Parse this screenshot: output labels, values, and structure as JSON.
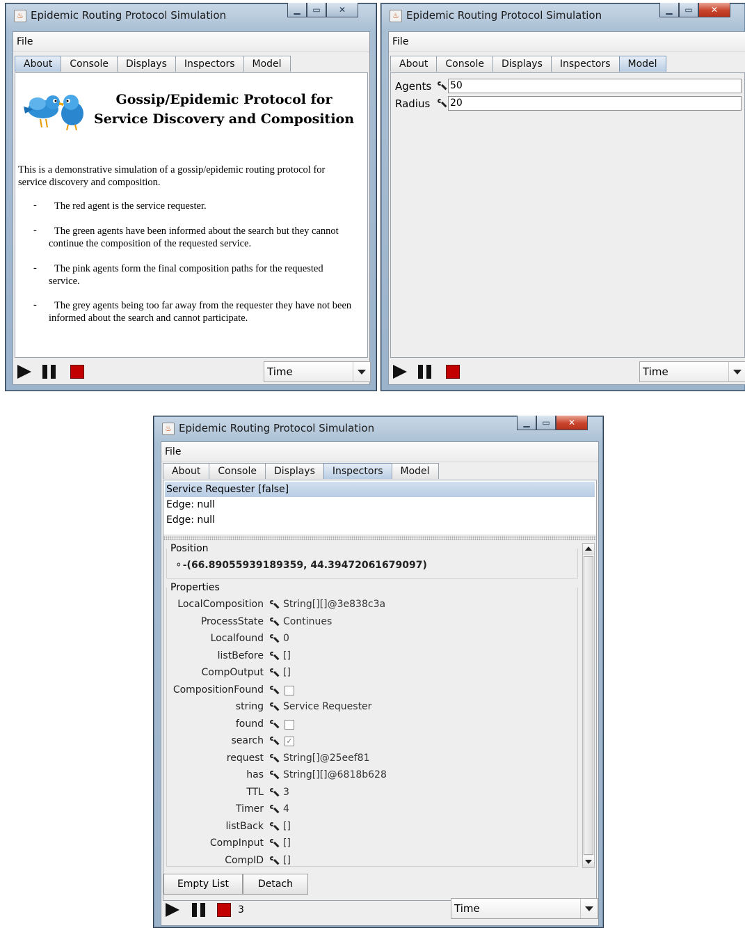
{
  "window_title": "Epidemic Routing Protocol Simulation",
  "menu_file": "File",
  "tabs": [
    "About",
    "Console",
    "Displays",
    "Inspectors",
    "Model"
  ],
  "time_combo": "Time",
  "about": {
    "heading": "Gossip/Epidemic Protocol for Service Discovery and Composition",
    "intro": "This is a demonstrative simulation of a gossip/epidemic routing protocol for service discovery and composition.",
    "bullets": [
      "The red agent is the service requester.",
      "The green agents have been informed about the search but they cannot continue the composition of the requested service.",
      "The pink agents form the final composition paths for the requested service.",
      "The grey agents being too far away from the requester they have not been informed about the search and cannot participate."
    ],
    "dash": "-"
  },
  "model": {
    "agents_label": "Agents",
    "agents_value": "50",
    "radius_label": "Radius",
    "radius_value": "20"
  },
  "inspectors": {
    "list": [
      "Service Requester [false]",
      "Edge: null",
      "Edge: null"
    ],
    "position_title": "Position",
    "position_value": "(66.89055939189359, 44.39472061679097)",
    "properties_title": "Properties",
    "properties": [
      {
        "label": "LocalComposition",
        "value": "String[][]@3e838c3a"
      },
      {
        "label": "ProcessState",
        "value": "Continues"
      },
      {
        "label": "Localfound",
        "value": "0"
      },
      {
        "label": "listBefore",
        "value": "[]"
      },
      {
        "label": "CompOutput",
        "value": "[]"
      },
      {
        "label": "CompositionFound",
        "checkbox": false
      },
      {
        "label": "string",
        "value": "Service Requester"
      },
      {
        "label": "found",
        "checkbox": false
      },
      {
        "label": "search",
        "checkbox": true
      },
      {
        "label": "request",
        "value": "String[]@25eef81"
      },
      {
        "label": "has",
        "value": "String[][]@6818b628"
      },
      {
        "label": "TTL",
        "value": "3"
      },
      {
        "label": "Timer",
        "value": "4"
      },
      {
        "label": "listBack",
        "value": "[]"
      },
      {
        "label": "CompInput",
        "value": "[]"
      },
      {
        "label": "CompID",
        "value": "[]"
      }
    ],
    "empty_list_button": "Empty List",
    "detach_button": "Detach",
    "steps": "3"
  }
}
